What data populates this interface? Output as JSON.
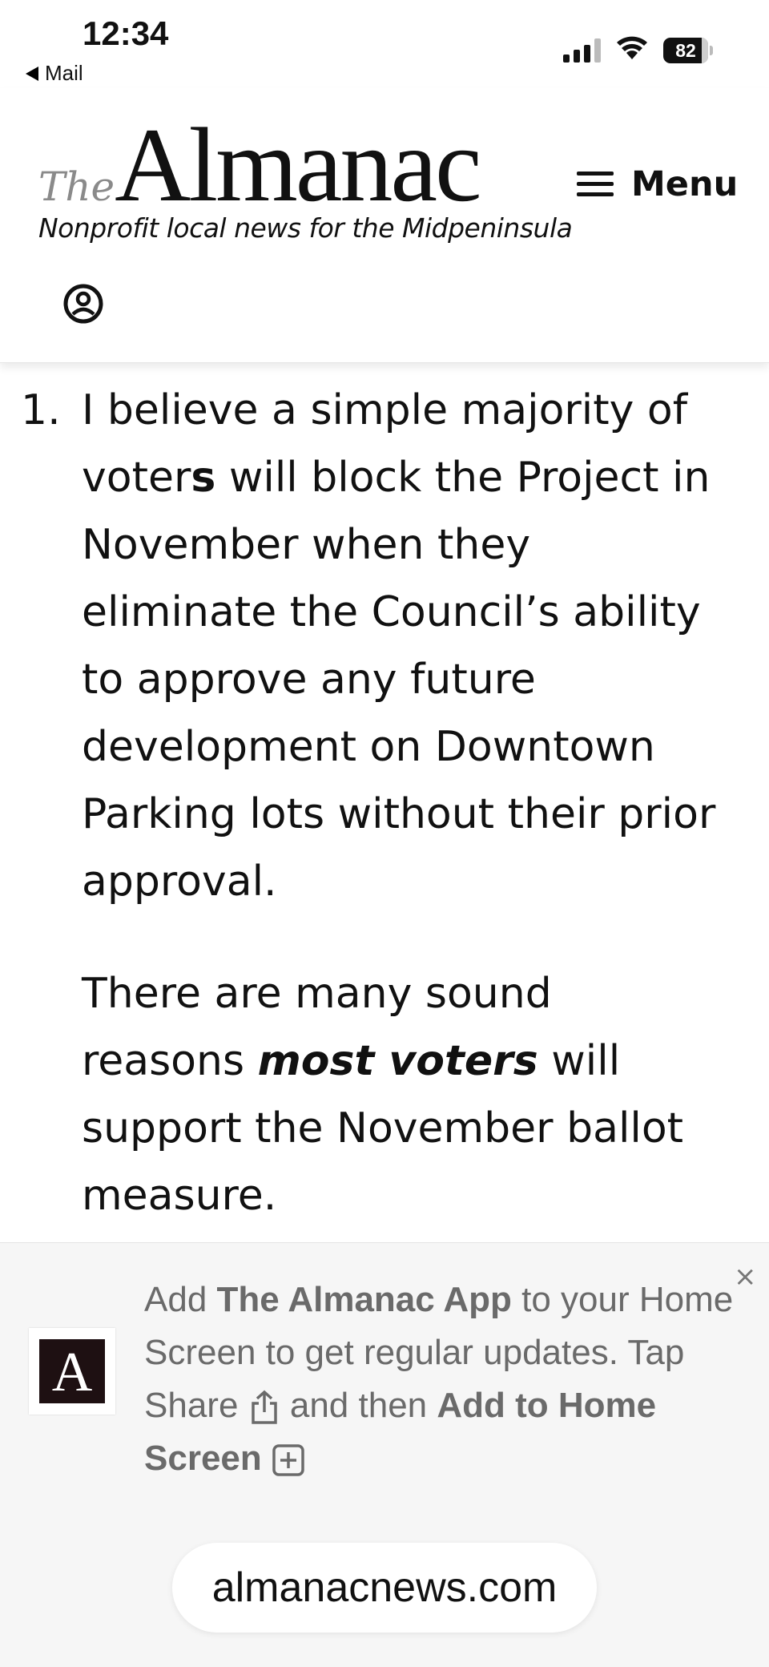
{
  "status_bar": {
    "time": "12:34",
    "back_app": "Mail",
    "battery": "82"
  },
  "header": {
    "logo_the": "The",
    "logo_name": "Almanac",
    "tagline": "Nonprofit local news for the Midpeninsula",
    "menu_label": "Menu"
  },
  "article": {
    "item_number": "1.",
    "item_text_1": "I believe a simple majority of voter",
    "item_text_bold": "s",
    "item_text_2": " will block the Project in November when they eliminate the Council’s ability to approve any future development on Downtown Parking lots without their prior approval.",
    "para_text_1": "There are many sound reasons ",
    "para_emphasis": "most voters",
    "para_text_2": " will support the November ballot measure."
  },
  "install_banner": {
    "close_glyph": "×",
    "icon_letter": "A",
    "text_add": "Add ",
    "app_name": "The Almanac App",
    "text_mid": " to your Home Screen to get regular updates. Tap Share ",
    "text_then": " and then ",
    "add_to_home": "Add to Home Screen"
  },
  "browser": {
    "url": "almanacnews.com"
  }
}
